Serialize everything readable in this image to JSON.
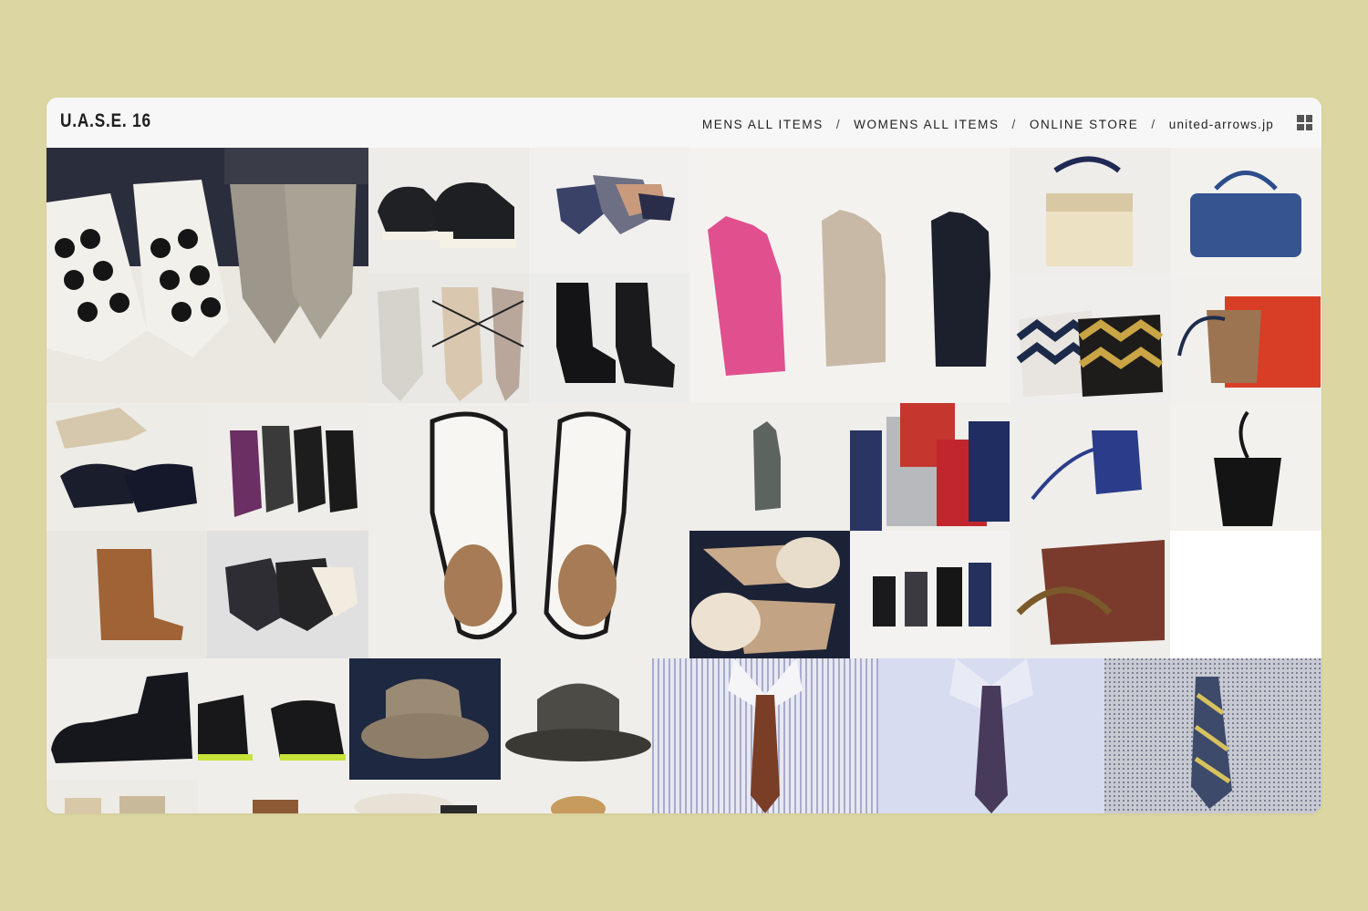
{
  "header": {
    "logo": "U.A.S.E. 16",
    "nav": [
      "MENS ALL ITEMS",
      "WOMENS ALL ITEMS",
      "ONLINE STORE",
      "united-arrows.jp"
    ],
    "separator": "/"
  },
  "tiles": [
    "polka-dot-and-tweed-pointed-flats",
    "black-sneakers",
    "color-block-pumps",
    "leather-gloves-pink-beige-navy",
    "cream-handbag",
    "blue-suede-bag",
    "lace-up-flats",
    "black-ankle-boots",
    "chevron-bucket-bags",
    "leopard-and-red-shoulder-bag",
    "black-pumps",
    "purple-studded-flats",
    "white-fur-derby-shoes",
    "camo-glove",
    "knit-gloves",
    "blue-fringe-pouch",
    "black-bucket-bag",
    "brown-ankle-boots",
    "mary-jane-heels",
    "suede-fur-gloves",
    "black-gloves-set",
    "bamboo-handle-bag",
    "black-lace-up-boots",
    "neon-sole-loafers",
    "fedora-hat",
    "bowler-hat",
    "shirt-and-brown-tie",
    "shirt-and-purple-tie",
    "check-shirt-and-striped-tie"
  ],
  "colors": {
    "background": "#dcd6a2",
    "window": "#f4f4f4"
  }
}
